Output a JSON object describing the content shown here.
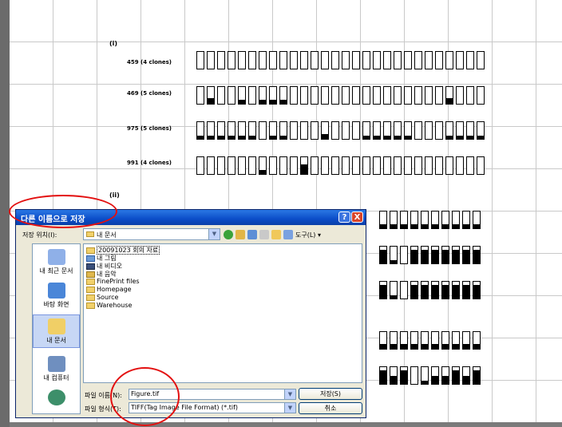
{
  "document": {
    "section_i": "(i)",
    "section_ii": "(ii)",
    "rows": [
      {
        "label": "459 (4 clones)",
        "fills": [
          0,
          0,
          0,
          0,
          0,
          0,
          0,
          0,
          0,
          0,
          0,
          0,
          0,
          0,
          0,
          0,
          0,
          0,
          0,
          0,
          0,
          0,
          0,
          0,
          0,
          0,
          0,
          0
        ]
      },
      {
        "label": "469 (5 clones)",
        "fills": [
          0,
          0.35,
          0,
          0,
          0.25,
          0,
          0.25,
          0.25,
          0.25,
          0,
          0,
          0,
          0,
          0,
          0,
          0,
          0,
          0,
          0,
          0,
          0,
          0,
          0,
          0,
          0.35,
          0,
          0,
          0
        ]
      },
      {
        "label": "975 (5 clones)",
        "fills": [
          0.2,
          0.2,
          0.2,
          0.2,
          0.2,
          0.2,
          0,
          0.2,
          0.2,
          0,
          0,
          0,
          0.3,
          0,
          0,
          0,
          0.2,
          0.2,
          0.2,
          0.2,
          0.2,
          0,
          0,
          0,
          0.2,
          0.2,
          0.2,
          0.2
        ]
      },
      {
        "label": "991 (4 clones)",
        "fills": [
          0,
          0,
          0,
          0,
          0,
          0,
          0.25,
          0,
          0,
          0,
          0.55,
          0,
          0,
          0,
          0,
          0,
          0,
          0,
          0,
          0,
          0,
          0,
          0,
          0,
          0,
          0,
          0,
          0
        ]
      }
    ],
    "partial_rows": [
      {
        "fills": [
          0.25,
          0.25,
          0.25,
          0.25,
          0.25,
          0.25,
          0.25,
          0.25,
          0.25,
          0.25
        ]
      },
      {
        "fills": [
          0.8,
          0.2,
          0,
          0.8,
          0.8,
          0.8,
          0.8,
          0.8,
          0.8,
          0.8
        ]
      },
      {
        "fills": [
          0.8,
          0.2,
          0,
          0.8,
          0.8,
          0.8,
          0.8,
          0.8,
          0.8,
          0.8
        ]
      },
      {
        "fills": [
          0.3,
          0.3,
          0.3,
          0.3,
          0.3,
          0.3,
          0.3,
          0.3,
          0.3,
          0.3
        ]
      },
      {
        "fills": [
          0.8,
          0.5,
          0.8,
          0,
          0.2,
          0.5,
          0.5,
          0.8,
          0.5,
          0.8
        ]
      }
    ]
  },
  "dialog": {
    "title": "다른 이름으로 저장",
    "help_glyph": "?",
    "close_glyph": "X",
    "save_in_label": "저장 위치(I):",
    "save_in_value": "내 문서",
    "tools_label": "도구(L) ▾",
    "places": [
      "내 최근 문서",
      "바탕 화면",
      "내 문서",
      "내 컴퓨터",
      ""
    ],
    "items": [
      {
        "name": "20091023 회의 자료",
        "icon": "folder"
      },
      {
        "name": "내 그림",
        "icon": "pictures"
      },
      {
        "name": "내 비디오",
        "icon": "video"
      },
      {
        "name": "내 음악",
        "icon": "music"
      },
      {
        "name": "FinePrint files",
        "icon": "folder"
      },
      {
        "name": "Homepage",
        "icon": "folder"
      },
      {
        "name": "Source",
        "icon": "folder"
      },
      {
        "name": "Warehouse",
        "icon": "folder"
      }
    ],
    "filename_label": "파일 이름(N):",
    "filename_value": "Figure.tif",
    "filetype_label": "파일 형식(T):",
    "filetype_value": "TIFF(Tag Image File Format) (*.tif)",
    "save_button": "저장(S)",
    "cancel_button": "취소"
  },
  "colors": {
    "annotation": "#e31010",
    "titlebar": "#0b4dc8"
  }
}
